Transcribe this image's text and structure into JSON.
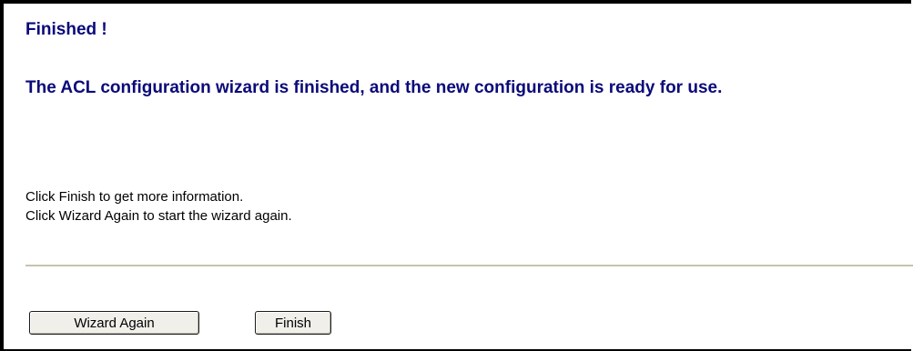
{
  "page": {
    "title": "Finished !",
    "headline": "The ACL configuration wizard is finished, and the new configuration is ready for use.",
    "instructions": [
      "Click Finish to get more information.",
      "Click Wizard Again to start the wizard again."
    ]
  },
  "buttons": {
    "wizard_again_label": "Wizard Again",
    "finish_label": "Finish"
  },
  "colors": {
    "heading": "#0a0a7a",
    "text": "#000000",
    "divider": "#c8c2ae",
    "button_face": "#f0efea",
    "frame_border": "#000000"
  }
}
